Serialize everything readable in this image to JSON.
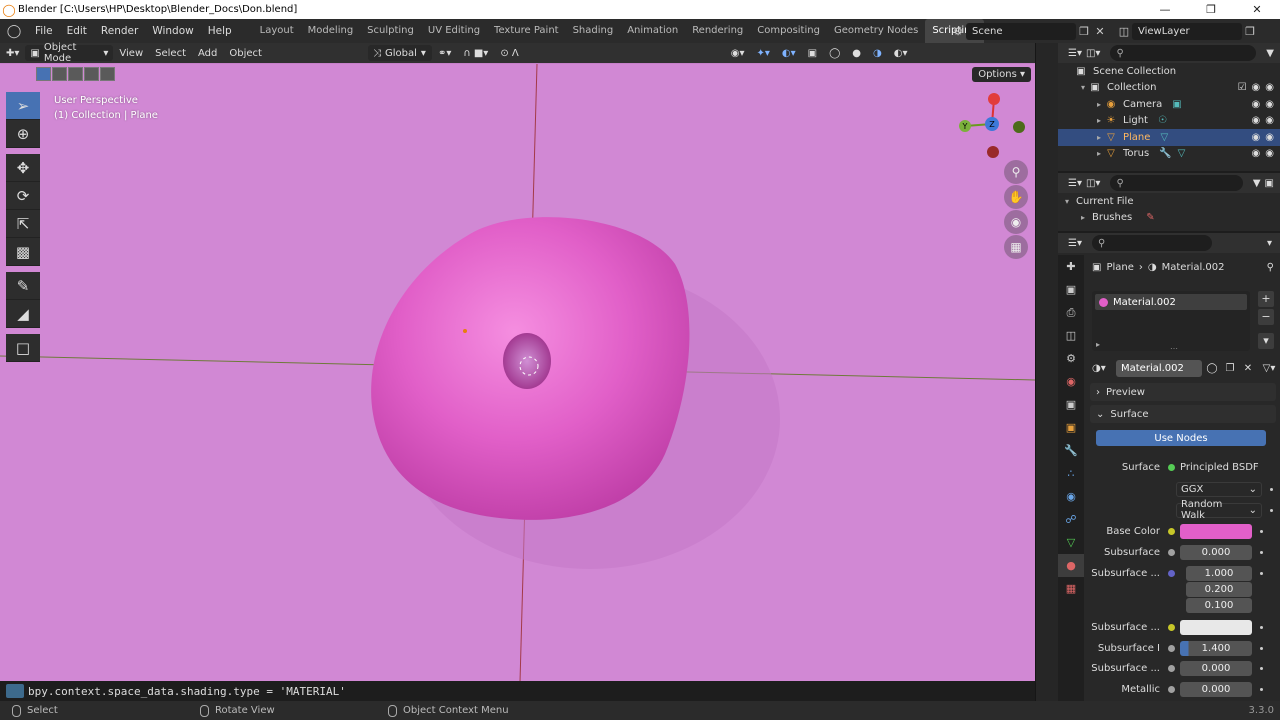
{
  "title_bar": {
    "text": "Blender [C:\\Users\\HP\\Desktop\\Blender_Docs\\Don.blend]"
  },
  "menu": [
    "File",
    "Edit",
    "Render",
    "Window",
    "Help"
  ],
  "workspaces": [
    "Layout",
    "Modeling",
    "Sculpting",
    "UV Editing",
    "Texture Paint",
    "Shading",
    "Animation",
    "Rendering",
    "Compositing",
    "Geometry Nodes",
    "Scripting"
  ],
  "active_workspace": "Scripting",
  "scene_field": "Scene",
  "viewlayer_field": "ViewLayer",
  "viewport_header": {
    "mode": "Object Mode",
    "menus": [
      "View",
      "Select",
      "Add",
      "Object"
    ],
    "orientation": "Global"
  },
  "viewport": {
    "perspective_label": "User Perspective",
    "collection_label": "(1) Collection | Plane",
    "options_label": "Options",
    "background_color": "#d188d4",
    "donut_color": "#e15fc8"
  },
  "gizmo": {
    "x_label": "",
    "y_label": "Y",
    "z_label": "Z"
  },
  "script_line": "bpy.context.space_data.shading.type = 'MATERIAL'",
  "status_bar": {
    "select": "Select",
    "rotate": "Rotate View",
    "context": "Object Context Menu",
    "version": "3.3.0"
  },
  "outliner": {
    "root": "Scene Collection",
    "collection": "Collection",
    "items": [
      {
        "label": "Camera",
        "selected": false
      },
      {
        "label": "Light",
        "selected": false
      },
      {
        "label": "Plane",
        "selected": true
      },
      {
        "label": "Torus",
        "selected": false
      }
    ]
  },
  "file_browser": {
    "current_file": "Current File",
    "brushes": "Brushes"
  },
  "properties": {
    "breadcrumb_object": "Plane",
    "breadcrumb_material": "Material.002",
    "slot_material": "Material.002",
    "material_name": "Material.002",
    "preview_label": "Preview",
    "surface_section": "Surface",
    "use_nodes": "Use Nodes",
    "surface_label": "Surface",
    "surface_value": "Principled BSDF",
    "distribution": "GGX",
    "subsurface_method": "Random Walk",
    "rows": [
      {
        "label": "Base Color",
        "value": "",
        "socket": "#c7c729",
        "swatch": "#e25fc9"
      },
      {
        "label": "Subsurface",
        "value": "0.000",
        "socket": "#a1a1a1"
      },
      {
        "label": "Subsurface ...",
        "value": "1.000",
        "socket": "#6363c7"
      },
      {
        "label": "",
        "value": "0.200"
      },
      {
        "label": "",
        "value": "0.100"
      },
      {
        "label": "Subsurface ...",
        "value": "",
        "socket": "#c7c729",
        "swatch": "#e8e8e8"
      },
      {
        "label": "Subsurface I",
        "value": "1.400",
        "socket": "#a1a1a1"
      },
      {
        "label": "Subsurface ...",
        "value": "0.000",
        "socket": "#a1a1a1"
      },
      {
        "label": "Metallic",
        "value": "0.000",
        "socket": "#a1a1a1"
      }
    ]
  }
}
